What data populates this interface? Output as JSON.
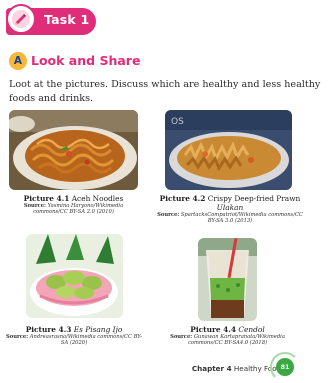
{
  "task": {
    "title": "Task 1",
    "icon": "pencil-icon"
  },
  "section": {
    "badge": "A",
    "title": "Look and Share"
  },
  "intro": "Loot at the pictures. Discuss which are healthy and less healthy foods and drinks.",
  "pictures": [
    {
      "label": "Picture 4.1",
      "title": "Aceh Noodles",
      "title_italic": "",
      "source_label": "Source:",
      "source": "Yasmina Haryono/Wikimedia commons/CC BY-SA 2.0 (2010)"
    },
    {
      "label": "Picture 4.2",
      "title": "Crispy Deep-fried Prawn",
      "title_italic": "Ulakan",
      "source_label": "Source:",
      "source": "SpartacksCompatriot/Wikimedia commons/CC BY-SA 3.0 (2013)"
    },
    {
      "label": "Picture 4.3",
      "title": "",
      "title_italic": "Es Pisang Ijo",
      "source_label": "Source:",
      "source": "Andreasrasna/Wikimedia commons/CC BY-SA (2020)"
    },
    {
      "label": "Picture 4.4",
      "title": "",
      "title_italic": "Cendol",
      "source_label": "Source:",
      "source": "Gunawan Kartapranata/Wikimedia commons/CC BY-SA4.0 (2018)"
    }
  ],
  "footer": {
    "chapter": "Chapter 4",
    "chapter_title": "Healthy Foods",
    "page": "81"
  },
  "colors": {
    "accent": "#e02d7a",
    "badge": "#f5b83a",
    "page": "#3aa843"
  }
}
